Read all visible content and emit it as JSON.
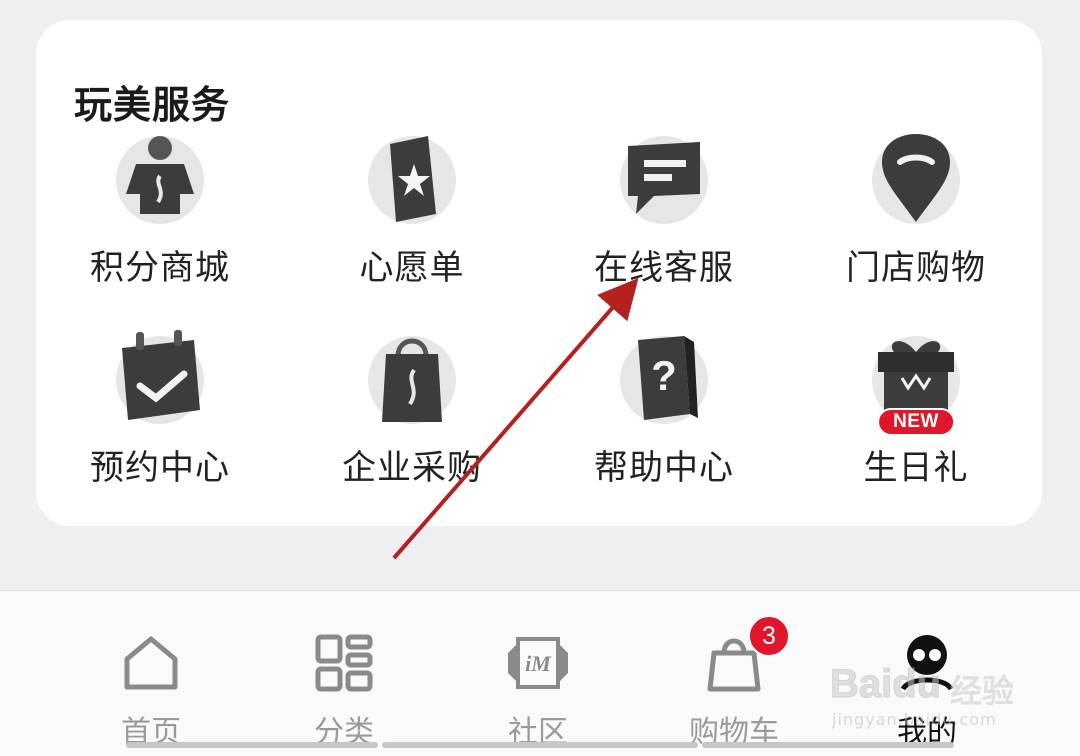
{
  "section": {
    "title": "玩美服务",
    "items": [
      {
        "label": "积分商城",
        "icon": "points-mall-icon"
      },
      {
        "label": "心愿单",
        "icon": "wishlist-icon"
      },
      {
        "label": "在线客服",
        "icon": "chat-bubble-icon"
      },
      {
        "label": "门店购物",
        "icon": "location-pin-icon"
      },
      {
        "label": "预约中心",
        "icon": "calendar-check-icon"
      },
      {
        "label": "企业采购",
        "icon": "shopping-bag-icon"
      },
      {
        "label": "帮助中心",
        "icon": "help-book-icon"
      },
      {
        "label": "生日礼",
        "icon": "gift-box-icon",
        "badge": "NEW"
      }
    ]
  },
  "tabbar": {
    "tabs": [
      {
        "label": "首页",
        "icon": "home-icon"
      },
      {
        "label": "分类",
        "icon": "category-grid-icon"
      },
      {
        "label": "社区",
        "icon": "community-icon"
      },
      {
        "label": "购物车",
        "icon": "cart-bag-icon",
        "badge": "3"
      },
      {
        "label": "我的",
        "icon": "avatar-icon",
        "active": true
      }
    ]
  },
  "watermark": {
    "logo": "Baidu",
    "text": "经验",
    "url": "jingyan.baidu.com"
  },
  "colors": {
    "accent": "#e0162b",
    "annotation_arrow": "#b3221f",
    "icon_dark": "#3a3a3a",
    "background": "#eeeef3"
  }
}
